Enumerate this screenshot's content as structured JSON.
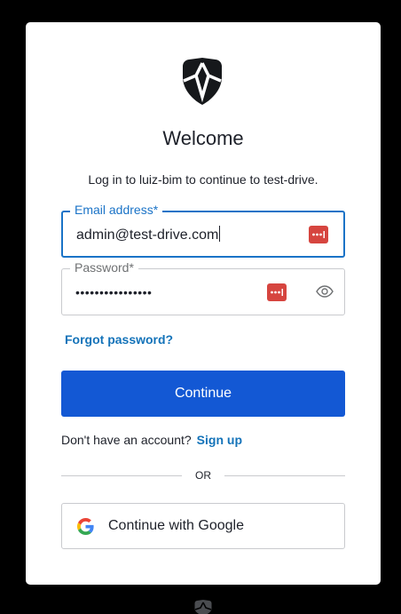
{
  "login": {
    "title": "Welcome",
    "subtitle": "Log in to luiz-bim to continue to test-drive.",
    "email": {
      "label": "Email address*",
      "value": "admin@test-drive.com"
    },
    "password": {
      "label": "Password*",
      "value": "••••••••••••••••"
    },
    "forgot_password": "Forgot password?",
    "continue_label": "Continue",
    "signup_prompt": "Don't have an account?",
    "signup_link": "Sign up",
    "divider_text": "OR",
    "google_label": "Continue with Google"
  },
  "colors": {
    "background": "#000000",
    "card": "#ffffff",
    "primary": "#1358d4",
    "link": "#1473b9",
    "focus": "#1a73c7",
    "password_manager": "#d6453f"
  },
  "icons": {
    "logo": "auth0-shield-logo",
    "password_manager": "password-manager-icon",
    "show_password": "eye-icon",
    "google": "google-logo-icon"
  }
}
